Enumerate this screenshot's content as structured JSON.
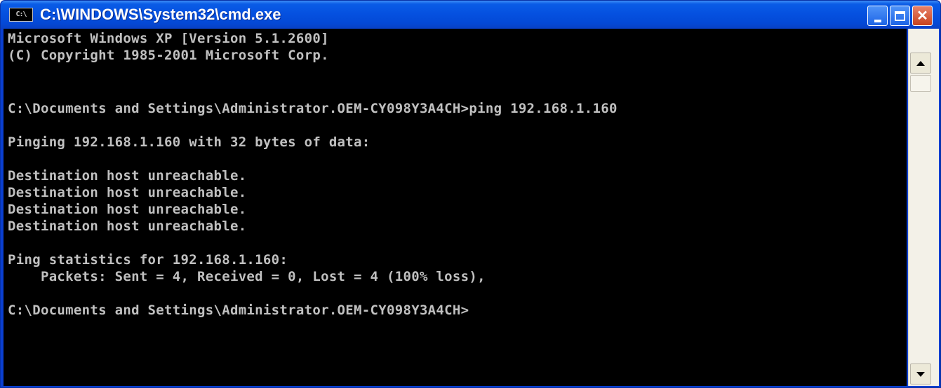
{
  "window": {
    "title": "C:\\WINDOWS\\System32\\cmd.exe",
    "icon_name": "cmd-icon",
    "icon_text": "C:\\",
    "controls": {
      "minimize": "minimize-icon",
      "maximize": "maximize-icon",
      "close": "close-icon",
      "close_glyph": "✕"
    }
  },
  "console": {
    "background": "#000000",
    "text_color": "#c0c0c0",
    "lines": [
      "Microsoft Windows XP [Version 5.1.2600]",
      "(C) Copyright 1985-2001 Microsoft Corp.",
      "C:\\Documents and Settings\\Administrator.OEM-CY098Y3A4CH>ping 192.168.1.160",
      "Pinging 192.168.1.160 with 32 bytes of data:",
      "Destination host unreachable.",
      "Destination host unreachable.",
      "Destination host unreachable.",
      "Destination host unreachable.",
      "Ping statistics for 192.168.1.160:",
      "    Packets: Sent = 4, Received = 0, Lost = 4 (100% loss),",
      "C:\\Documents and Settings\\Administrator.OEM-CY098Y3A4CH>"
    ]
  },
  "scrollbar": {
    "up_icon": "scroll-up-arrow-icon",
    "down_icon": "scroll-down-arrow-icon"
  },
  "colors": {
    "titlebar": "#0551e0",
    "close_button": "#c8431e"
  }
}
